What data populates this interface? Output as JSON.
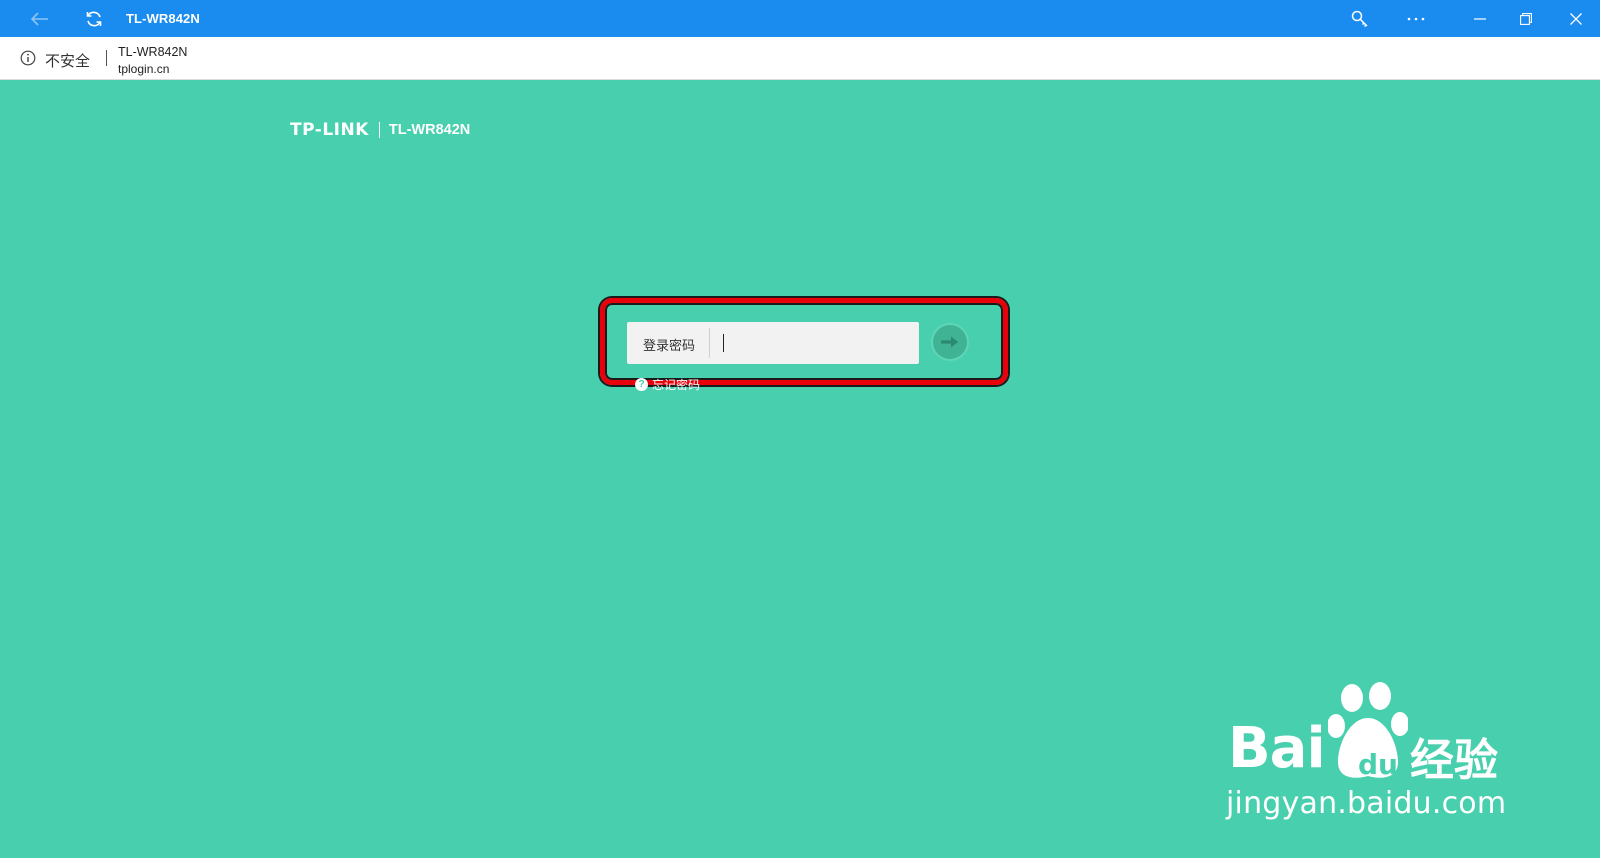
{
  "browser": {
    "tab_title": "TL-WR842N",
    "security_label": "不安全",
    "page_name": "TL-WR842N",
    "page_url": "tplogin.cn"
  },
  "header": {
    "brand": "TP-LINK",
    "model": "TL-WR842N"
  },
  "login": {
    "label": "登录密码",
    "value": "",
    "forgot_label": "忘记密码"
  },
  "watermark": {
    "brand": "Bai",
    "du": "du",
    "jingyan": "经验",
    "url": "jingyan.baidu.com"
  },
  "colors": {
    "titlebar": "#1a8cf0",
    "page_background": "#48cfad",
    "highlight_border": "#e8000a"
  }
}
